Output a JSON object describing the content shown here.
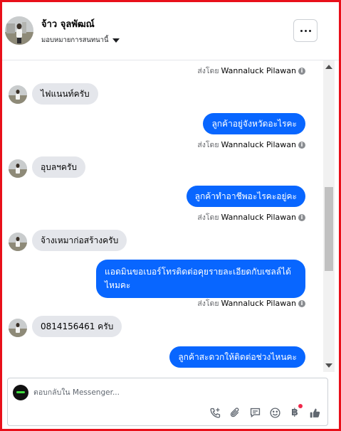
{
  "header": {
    "contact_name": "จ้าว จุลพัฒณ์",
    "assign_label": "มอบหมายการสนทนานี้"
  },
  "messages": [
    {
      "type": "sent_by",
      "prefix": "ส่งโดย",
      "sender": "Wannaluck Pilawan"
    },
    {
      "type": "in",
      "text": "ไฟแนนท์ครับ"
    },
    {
      "type": "out",
      "text": "ลูกค้าอยู่จังหวัดอะไรคะ"
    },
    {
      "type": "sent_by",
      "prefix": "ส่งโดย",
      "sender": "Wannaluck Pilawan"
    },
    {
      "type": "in",
      "text": "อุบลฯครับ"
    },
    {
      "type": "out",
      "text": "ลูกค้าทำอาชีพอะไรคะอยู่คะ"
    },
    {
      "type": "sent_by",
      "prefix": "ส่งโดย",
      "sender": "Wannaluck Pilawan"
    },
    {
      "type": "in",
      "text": "จ้างเหมาก่อสร้างครับ"
    },
    {
      "type": "out",
      "text": "แอดมินขอเบอร์โทรติดต่อคุยรายละเอียดกับเซลล์ได้ไหมคะ"
    },
    {
      "type": "sent_by",
      "prefix": "ส่งโดย",
      "sender": "Wannaluck Pilawan"
    },
    {
      "type": "in",
      "text": "0814156461 ครับ"
    },
    {
      "type": "out",
      "text": "ลูกค้าสะดวกให้ติดต่อช่วงไหนคะ"
    }
  ],
  "composer": {
    "placeholder": "ตอบกลับใน Messenger..."
  },
  "toolbar_icons": [
    "phone-plus-icon",
    "attachment-icon",
    "saved-reply-icon",
    "emoji-icon",
    "baht-icon",
    "thumbs-up-icon"
  ],
  "colors": {
    "accent": "#0866ff",
    "incoming_bubble": "#e4e6eb",
    "frame_border": "#e8101a"
  }
}
